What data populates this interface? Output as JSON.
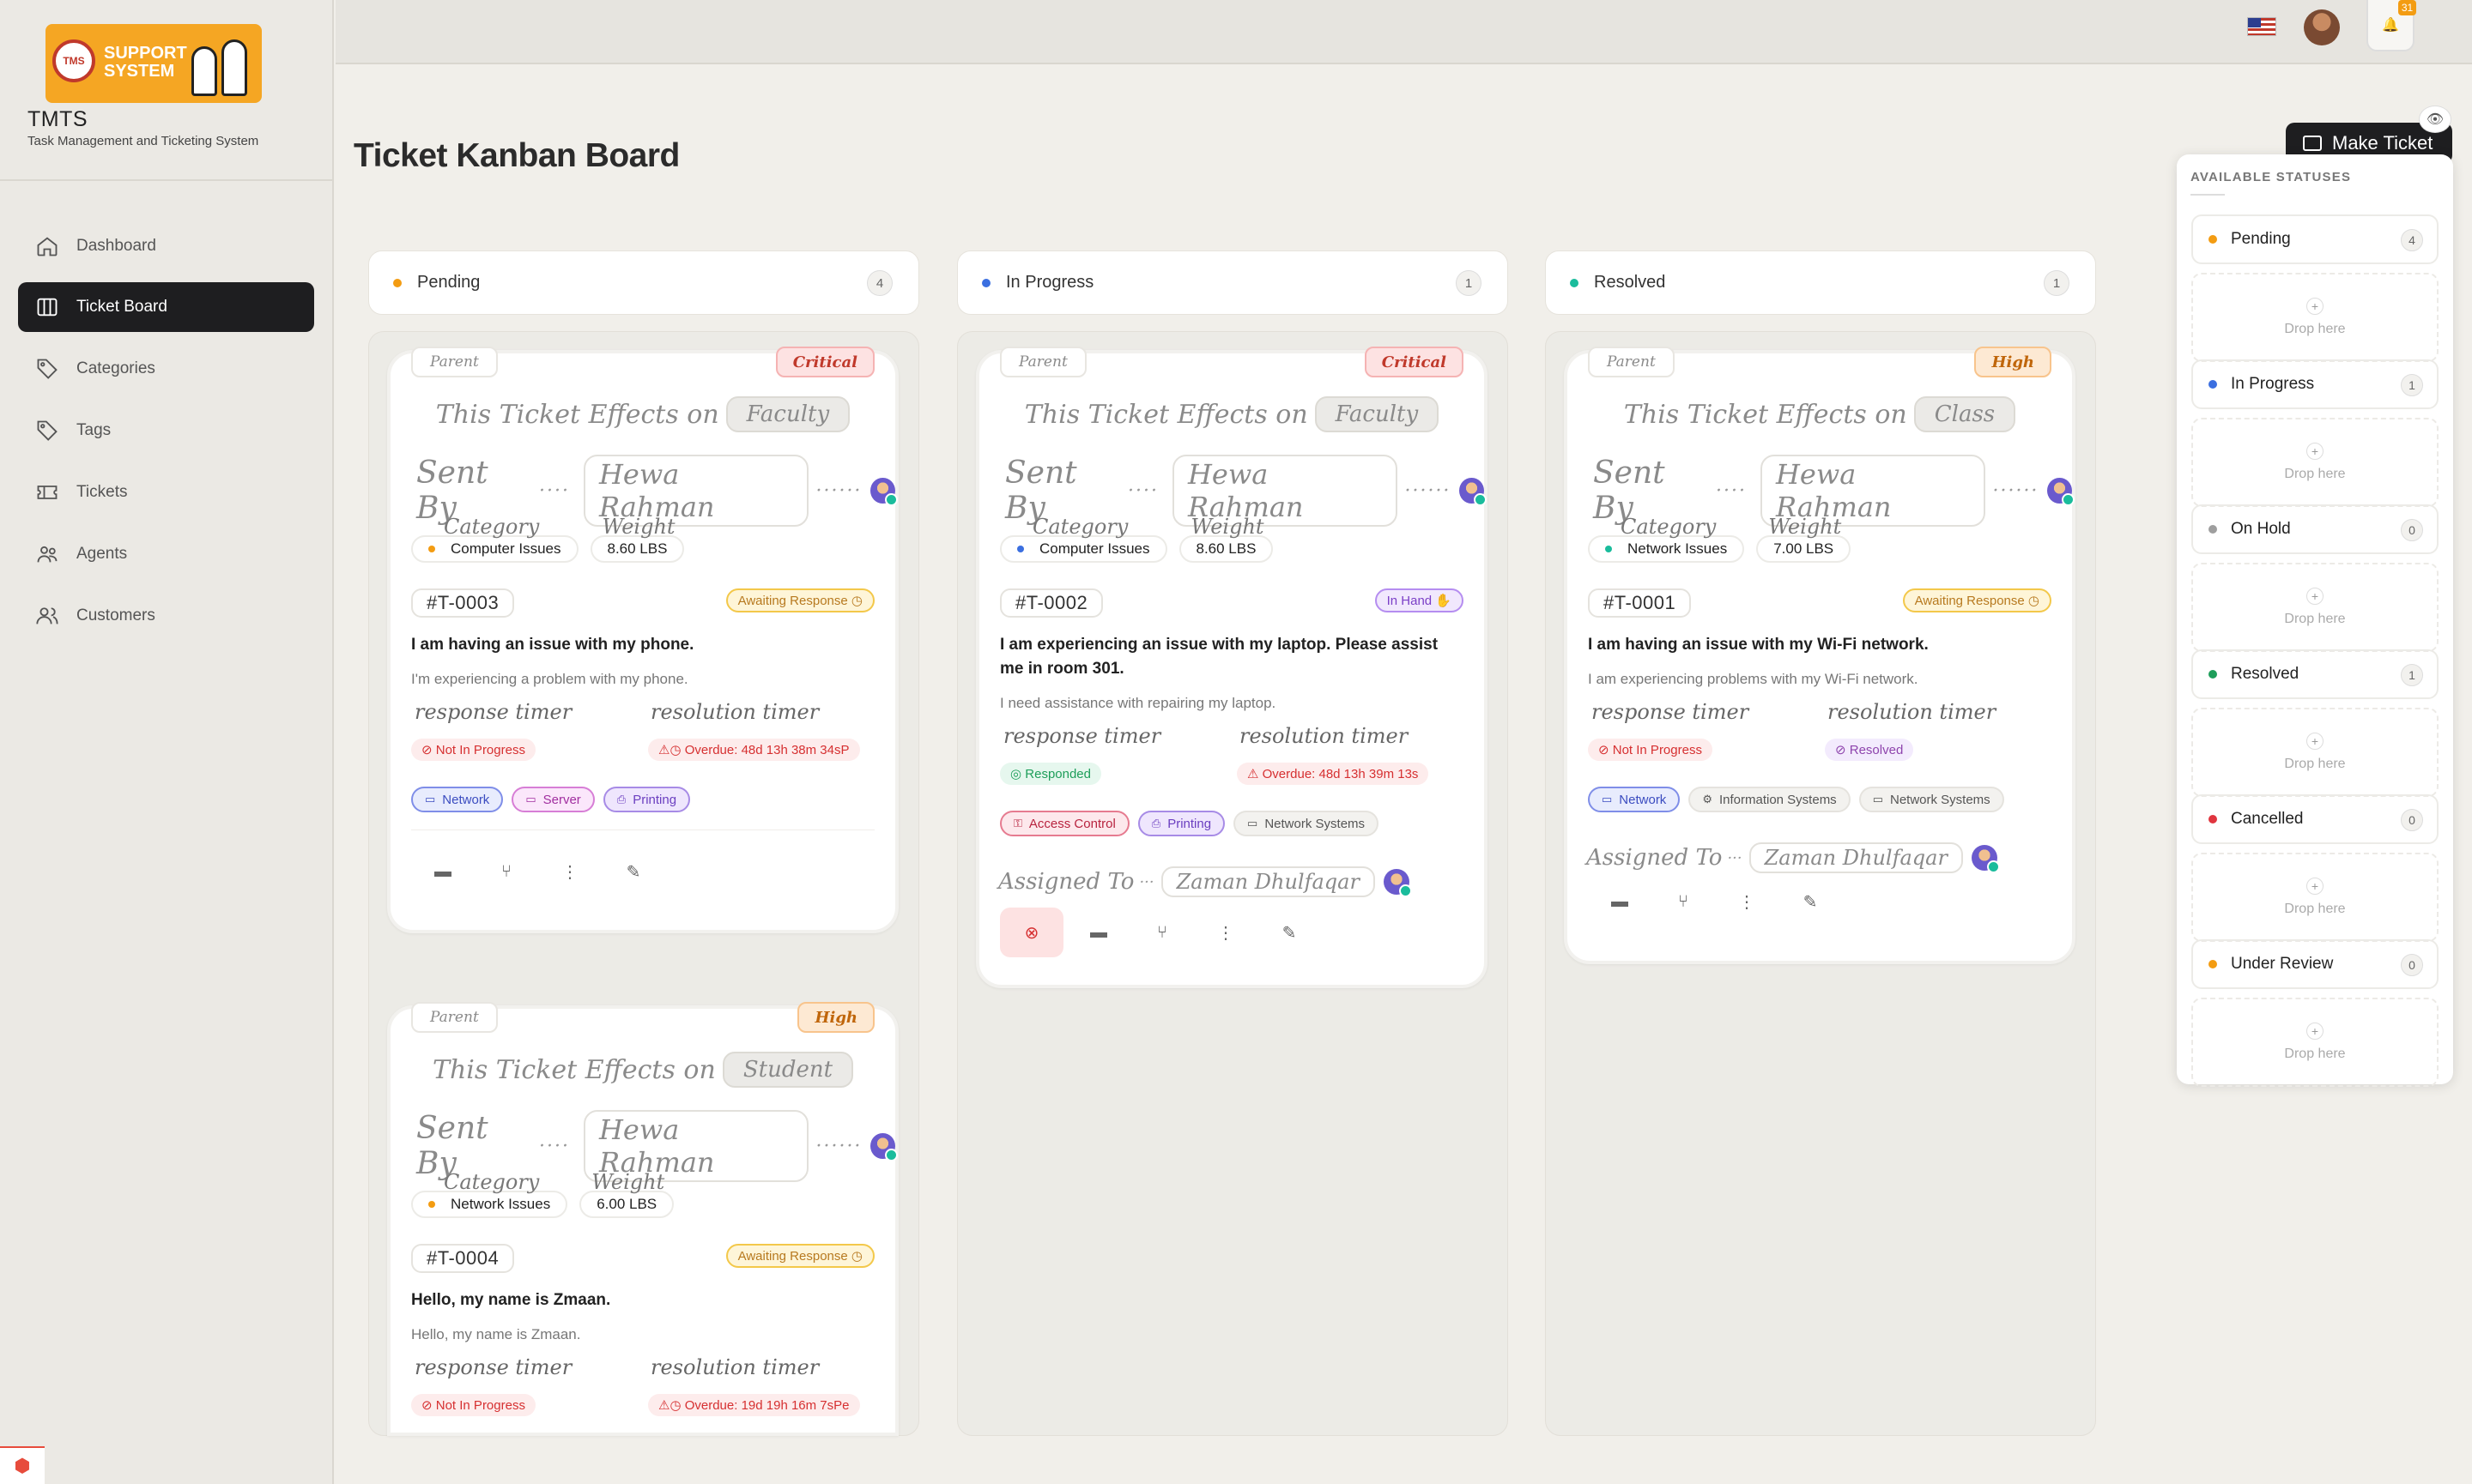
{
  "app": {
    "logo_text_1": "SUPPORT",
    "logo_text_2": "SYSTEM",
    "logo_seal": "TMS",
    "name": "TMTS",
    "subtitle": "Task Management and Ticketing System"
  },
  "sidebar": {
    "items": [
      {
        "label": "Dashboard",
        "icon": "home-icon"
      },
      {
        "label": "Ticket Board",
        "icon": "columns-icon"
      },
      {
        "label": "Categories",
        "icon": "tag-icon"
      },
      {
        "label": "Tags",
        "icon": "tag-icon"
      },
      {
        "label": "Tickets",
        "icon": "ticket-icon"
      },
      {
        "label": "Agents",
        "icon": "users-icon"
      },
      {
        "label": "Customers",
        "icon": "customers-icon"
      }
    ]
  },
  "topbar": {
    "notifications": "31",
    "flag": "US"
  },
  "page": {
    "title": "Ticket Kanban Board",
    "make_ticket": "Make Ticket"
  },
  "columns": [
    {
      "name": "Pending",
      "count": "4",
      "color": "#f39c12"
    },
    {
      "name": "In Progress",
      "count": "1",
      "color": "#3b6fe0"
    },
    {
      "name": "Resolved",
      "count": "1",
      "color": "#1abc9c"
    }
  ],
  "labels": {
    "parent": "Parent",
    "effects": "This Ticket Effects on",
    "sent_by": "Sent By",
    "category": "Category",
    "weight": "Weight",
    "response_timer": "response timer",
    "resolution_timer": "resolution timer",
    "assigned_to": "Assigned To"
  },
  "tickets": {
    "t3": {
      "priority": "Critical",
      "effects": "Faculty",
      "sender": "Hewa Rahman",
      "category": "Computer Issues",
      "weight": "8.60 LBS",
      "id": "#T-0003",
      "status": "Awaiting Response",
      "title": "I am having an issue with my phone.",
      "description": "I'm experiencing a problem with my phone.",
      "response": "Not In Progress",
      "resolution": "Overdue: 48d 13h 38m 34sP",
      "tags": [
        "Network",
        "Server",
        "Printing"
      ]
    },
    "t4": {
      "priority": "High",
      "effects": "Student",
      "sender": "Hewa Rahman",
      "category": "Network Issues",
      "weight": "6.00 LBS",
      "id": "#T-0004",
      "status": "Awaiting Response",
      "title": "Hello, my name is Zmaan.",
      "description": "Hello, my name is Zmaan.",
      "response": "Not In Progress",
      "resolution": "Overdue: 19d 19h 16m 7sPe"
    },
    "t2": {
      "priority": "Critical",
      "effects": "Faculty",
      "sender": "Hewa Rahman",
      "category": "Computer Issues",
      "weight": "8.60 LBS",
      "id": "#T-0002",
      "status": "In Hand",
      "title": "I am experiencing an issue with my laptop. Please assist me in room 301.",
      "description": "I need assistance with repairing my laptop.",
      "response": "Responded",
      "resolution": "Overdue: 48d 13h 39m 13s",
      "tags": [
        "Access Control",
        "Printing",
        "Network Systems"
      ],
      "assignee": "Zaman Dhulfaqar"
    },
    "t1": {
      "priority": "High",
      "effects": "Class",
      "sender": "Hewa Rahman",
      "category": "Network Issues",
      "weight": "7.00 LBS",
      "id": "#T-0001",
      "status": "Awaiting Response",
      "title": "I am having an issue with my Wi-Fi network.",
      "description": "I am experiencing problems with my Wi-Fi network.",
      "response": "Not In Progress",
      "resolution": "Resolved",
      "tags": [
        "Network",
        "Information Systems",
        "Network Systems"
      ],
      "assignee": "Zaman Dhulfaqar"
    }
  },
  "panel": {
    "title": "AVAILABLE STATUSES",
    "drop_text": "Drop here",
    "statuses": [
      {
        "name": "Pending",
        "count": "4",
        "color": "#f39c12"
      },
      {
        "name": "In Progress",
        "count": "1",
        "color": "#3b6fe0"
      },
      {
        "name": "On Hold",
        "count": "0",
        "color": "#9e9e9e"
      },
      {
        "name": "Resolved",
        "count": "1",
        "color": "#1e9e5a"
      },
      {
        "name": "Cancelled",
        "count": "0",
        "color": "#e0353f"
      },
      {
        "name": "Under Review",
        "count": "0",
        "color": "#f39c12"
      }
    ]
  }
}
